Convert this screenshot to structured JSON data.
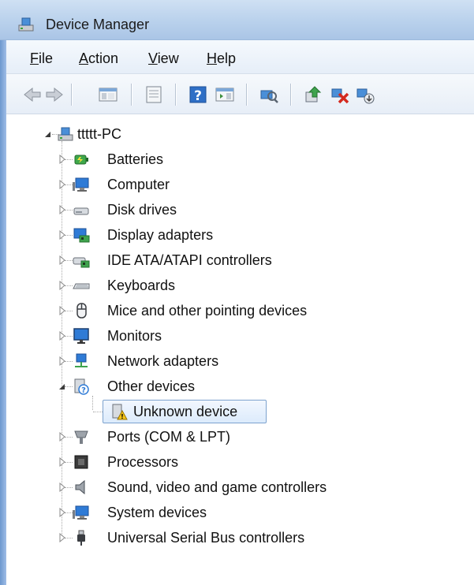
{
  "window": {
    "title": "Device Manager"
  },
  "menu": [
    {
      "label": "File",
      "underline": "F",
      "rest": "ile"
    },
    {
      "label": "Action",
      "underline": "A",
      "rest": "ction"
    },
    {
      "label": "View",
      "underline": "V",
      "rest": "iew"
    },
    {
      "label": "Help",
      "underline": "H",
      "rest": "elp"
    }
  ],
  "toolbar": {
    "buttons": [
      "back-icon",
      "forward-icon",
      "show-hide-console-tree-icon",
      "properties-icon",
      "help-icon",
      "show-action-pane-icon",
      "scan-hardware-changes-icon",
      "update-driver-icon",
      "uninstall-device-icon",
      "disable-device-icon"
    ]
  },
  "tree": {
    "root": {
      "label": "ttttt-PC",
      "expanded": true
    },
    "categories": [
      {
        "label": "Batteries",
        "icon": "battery-icon"
      },
      {
        "label": "Computer",
        "icon": "computer-icon"
      },
      {
        "label": "Disk drives",
        "icon": "disk-drive-icon"
      },
      {
        "label": "Display adapters",
        "icon": "display-adapter-icon"
      },
      {
        "label": "IDE ATA/ATAPI controllers",
        "icon": "ide-controller-icon"
      },
      {
        "label": "Keyboards",
        "icon": "keyboard-icon"
      },
      {
        "label": "Mice and other pointing devices",
        "icon": "mouse-icon"
      },
      {
        "label": "Monitors",
        "icon": "monitor-icon"
      },
      {
        "label": "Network adapters",
        "icon": "network-adapter-icon"
      },
      {
        "label": "Other devices",
        "icon": "other-devices-icon",
        "expanded": true,
        "children": [
          {
            "label": "Unknown device",
            "icon": "unknown-device-warning-icon",
            "selected": true
          }
        ]
      },
      {
        "label": "Ports (COM & LPT)",
        "icon": "port-icon"
      },
      {
        "label": "Processors",
        "icon": "processor-icon"
      },
      {
        "label": "Sound, video and game controllers",
        "icon": "speaker-icon"
      },
      {
        "label": "System devices",
        "icon": "system-devices-icon"
      },
      {
        "label": "Universal Serial Bus controllers",
        "icon": "usb-icon"
      }
    ]
  }
}
